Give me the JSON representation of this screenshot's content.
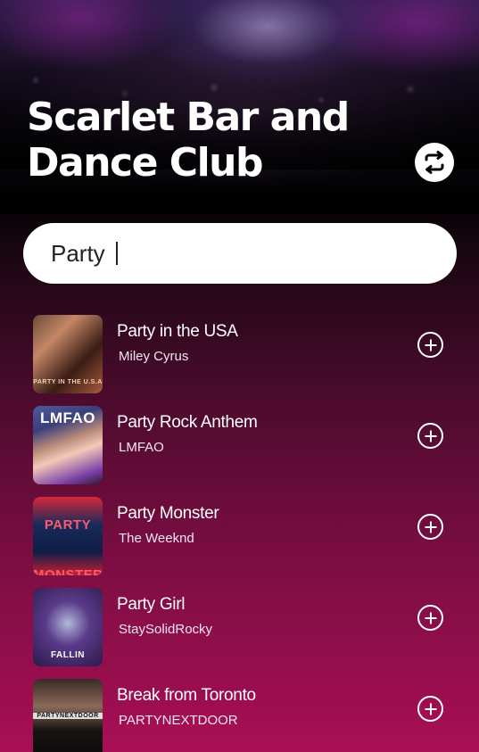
{
  "header": {
    "title": "Scarlet Bar and Dance Club",
    "switch_icon": "swap-arrows-icon"
  },
  "search": {
    "value": "Party"
  },
  "results": [
    {
      "song": "Party in the USA",
      "artist": "Miley Cyrus",
      "art_text": "PARTY IN THE U.S.A"
    },
    {
      "song": "Party Rock Anthem",
      "artist": "LMFAO",
      "art_text": "LMFAO"
    },
    {
      "song": "Party Monster",
      "artist": "The Weeknd",
      "art_text": "PARTY MONSTER"
    },
    {
      "song": "Party Girl",
      "artist": "StaySolidRocky",
      "art_text": "FALLIN"
    },
    {
      "song": "Break from Toronto",
      "artist": "PARTYNEXTDOOR",
      "art_text": "PARTYNEXTDOOR"
    }
  ],
  "colors": {
    "accent": "#a80f55",
    "background_top": "#000000",
    "text": "#ffffff"
  }
}
